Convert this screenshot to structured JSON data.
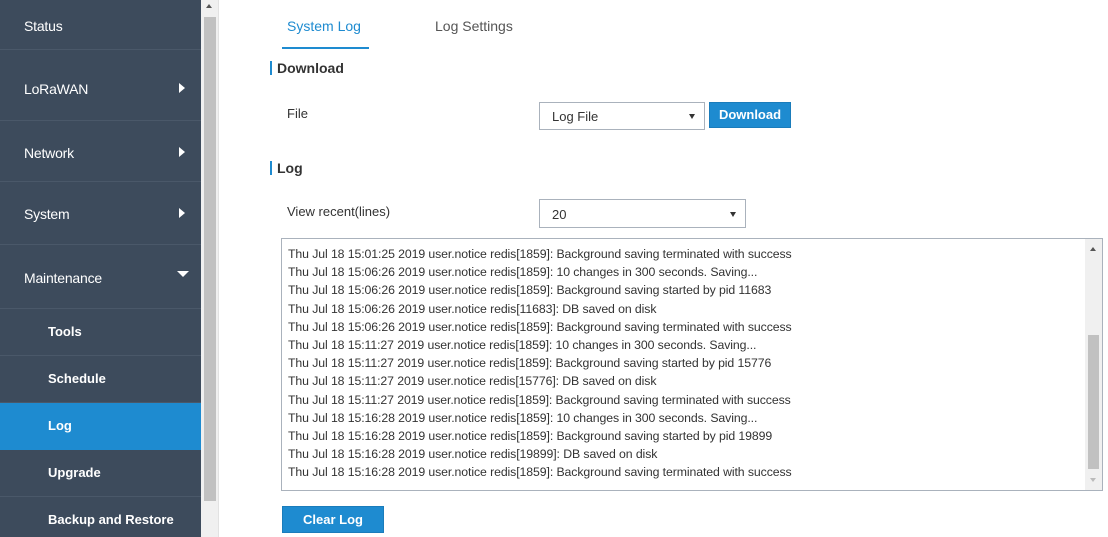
{
  "sidebar": {
    "status": "Status",
    "lorawan": "LoRaWAN",
    "network": "Network",
    "system": "System",
    "maintenance": "Maintenance",
    "sub_items": [
      "Tools",
      "Schedule",
      "Log",
      "Upgrade",
      "Backup and Restore"
    ],
    "active_sub_item": "Log"
  },
  "tabs": {
    "system_log": "System Log",
    "log_settings": "Log Settings",
    "active": "System Log"
  },
  "download": {
    "title": "Download",
    "file_label": "File",
    "file_select_value": "Log File",
    "download_button": "Download"
  },
  "log": {
    "title": "Log",
    "view_recent_label": "View recent(lines)",
    "view_recent_value": "20",
    "lines": [
      "Thu Jul 18 15:01:25 2019 user.notice redis[1859]: Background saving terminated with success",
      "Thu Jul 18 15:06:26 2019 user.notice redis[1859]: 10 changes in 300 seconds. Saving...",
      "Thu Jul 18 15:06:26 2019 user.notice redis[1859]: Background saving started by pid 11683",
      "Thu Jul 18 15:06:26 2019 user.notice redis[11683]: DB saved on disk",
      "Thu Jul 18 15:06:26 2019 user.notice redis[1859]: Background saving terminated with success",
      "Thu Jul 18 15:11:27 2019 user.notice redis[1859]: 10 changes in 300 seconds. Saving...",
      "Thu Jul 18 15:11:27 2019 user.notice redis[1859]: Background saving started by pid 15776",
      "Thu Jul 18 15:11:27 2019 user.notice redis[15776]: DB saved on disk",
      "Thu Jul 18 15:11:27 2019 user.notice redis[1859]: Background saving terminated with success",
      "Thu Jul 18 15:16:28 2019 user.notice redis[1859]: 10 changes in 300 seconds. Saving...",
      "Thu Jul 18 15:16:28 2019 user.notice redis[1859]: Background saving started by pid 19899",
      "Thu Jul 18 15:16:28 2019 user.notice redis[19899]: DB saved on disk",
      "Thu Jul 18 15:16:28 2019 user.notice redis[1859]: Background saving terminated with success"
    ],
    "clear_button": "Clear Log"
  },
  "colors": {
    "accent": "#1e8bd0",
    "sidebar_bg": "#3d4b5c"
  }
}
